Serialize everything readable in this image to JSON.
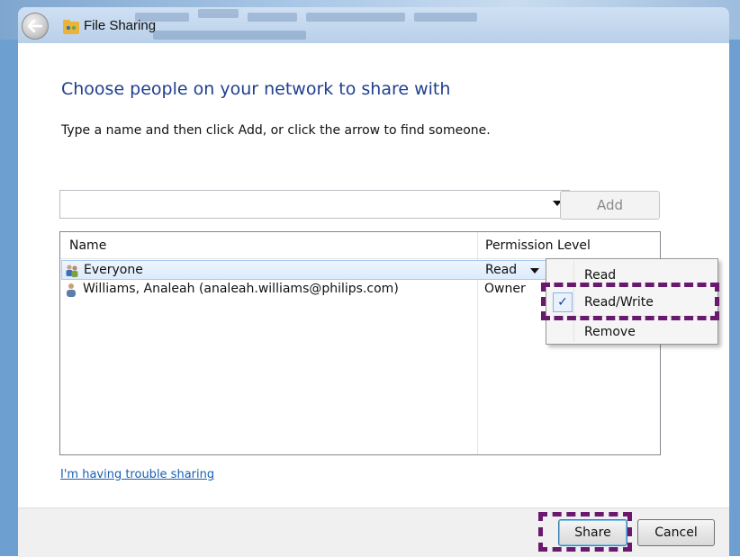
{
  "window": {
    "title": "File Sharing"
  },
  "dialog": {
    "heading": "Choose people on your network to share with",
    "instruction": "Type a name and then click Add, or click the arrow to find someone.",
    "name_input": {
      "value": "",
      "placeholder": ""
    },
    "add_label": "Add",
    "columns": {
      "name": "Name",
      "permission": "Permission Level"
    },
    "rows": [
      {
        "name": "Everyone",
        "permission": "Read",
        "icon": "group-icon",
        "selected": true
      },
      {
        "name": "Williams, Analeah (analeah.williams@philips.com)",
        "permission": "Owner",
        "icon": "user-icon",
        "selected": false
      }
    ],
    "trouble_link": "I'm having trouble sharing",
    "share_label": "Share",
    "cancel_label": "Cancel"
  },
  "permission_menu": {
    "items": [
      {
        "label": "Read",
        "checked": false
      },
      {
        "label": "Read/Write",
        "checked": true
      },
      {
        "label": "Remove",
        "checked": false
      }
    ],
    "check_glyph": "✓"
  },
  "colors": {
    "heading": "#1f3f8f",
    "link": "#1a5fb4",
    "highlight": "#6a1a6e",
    "selection": "#dcebfc"
  }
}
